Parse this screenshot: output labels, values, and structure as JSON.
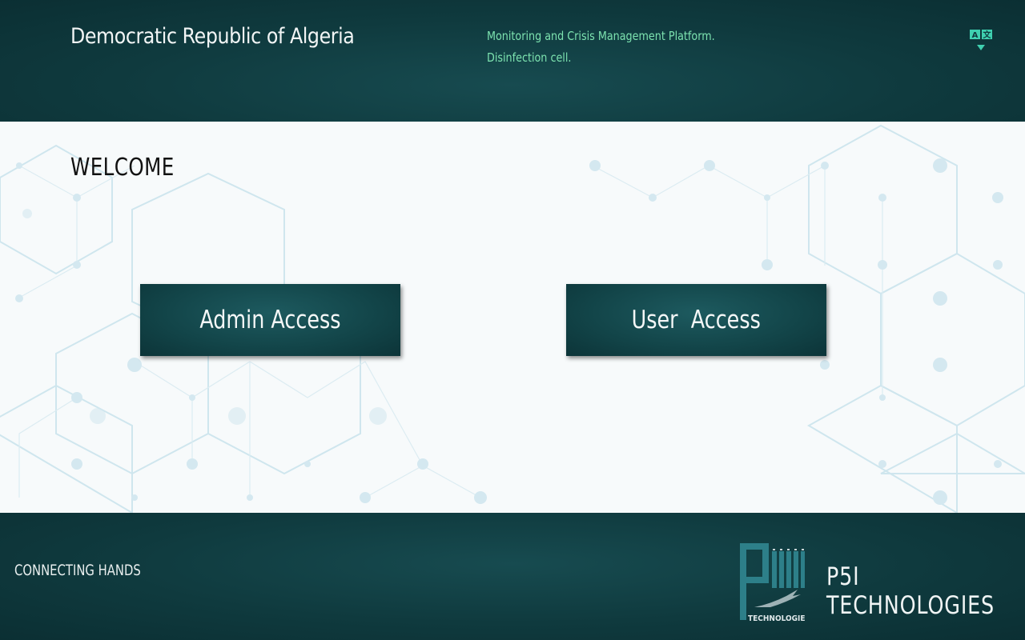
{
  "header": {
    "country": "Democratic Republic of Algeria",
    "platform_line1": "Monitoring and Crisis Management Platform.",
    "platform_line2": "Disinfection cell.",
    "language_icon": "translate-icon"
  },
  "main": {
    "welcome": "WELCOME",
    "admin_label": "Admin Access",
    "user_label": "User  Access"
  },
  "footer": {
    "tagline": "CONNECTING HANDS",
    "company": "P5I TECHNOLOGIES",
    "logo_text": "TECHNOLOGIES"
  },
  "colors": {
    "header_bg": "#0f3a3e",
    "accent_green": "#7de3b0",
    "button_bg": "#124448",
    "content_bg": "#f7fafb"
  }
}
